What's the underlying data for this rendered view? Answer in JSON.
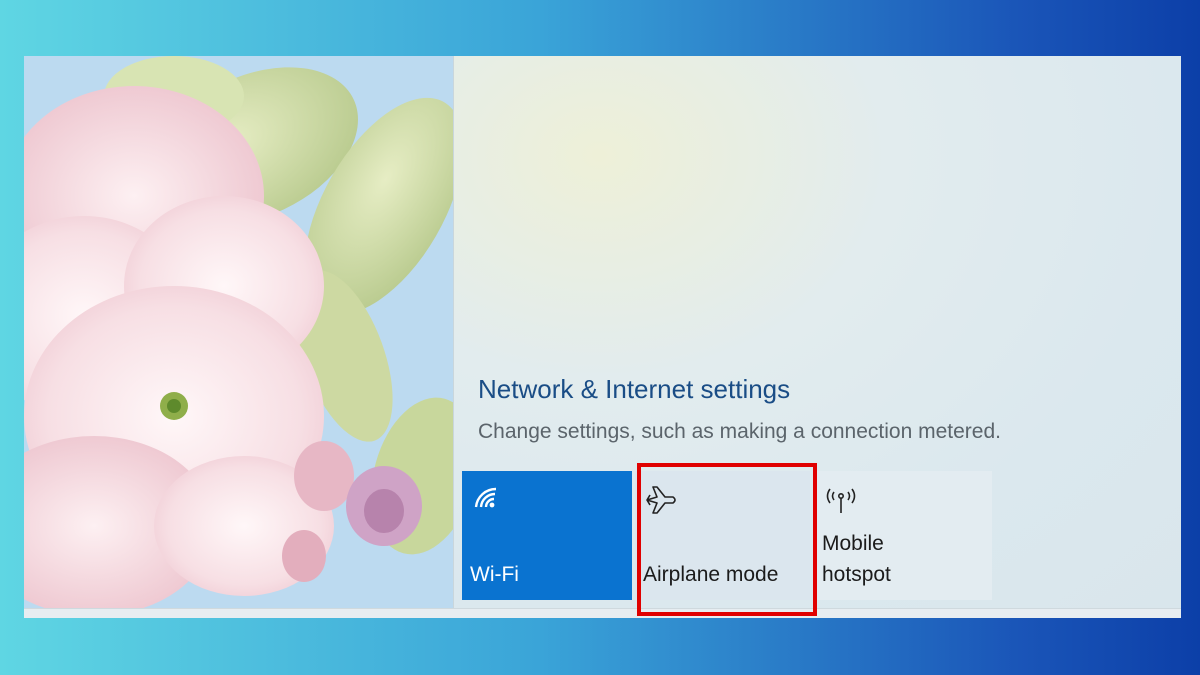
{
  "flyout": {
    "title": "Network & Internet settings",
    "description": "Change settings, such as making a connection metered."
  },
  "quick_actions": [
    {
      "label": "Wi-Fi",
      "icon": "wifi-icon",
      "active": true
    },
    {
      "label": "Airplane mode",
      "icon": "airplane-icon",
      "active": false
    },
    {
      "label": "Mobile\nhotspot",
      "icon": "mobile-hotspot-icon",
      "active": false
    }
  ],
  "colors": {
    "accent": "#0a73d0",
    "highlight_box": "#e00000",
    "title_text": "#1a4d86"
  }
}
